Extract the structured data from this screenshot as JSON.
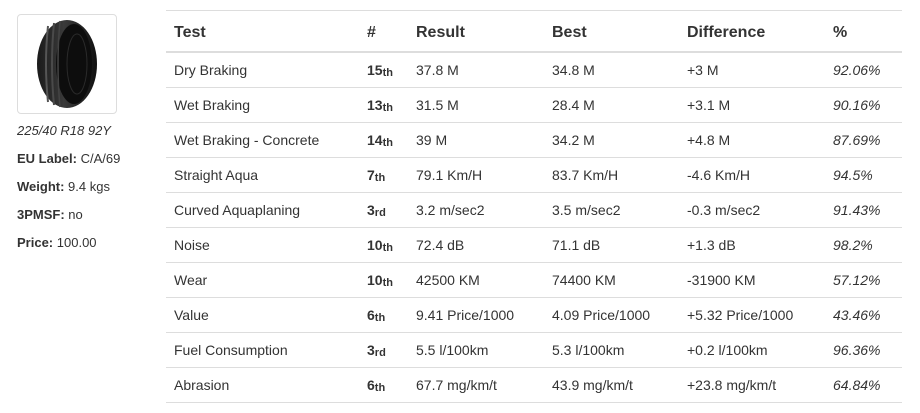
{
  "tyre": {
    "size": "225/40 R18 92Y",
    "specs": [
      {
        "label": "EU Label:",
        "value": "C/A/69"
      },
      {
        "label": "Weight:",
        "value": "9.4 kgs"
      },
      {
        "label": "3PMSF:",
        "value": "no"
      },
      {
        "label": "Price:",
        "value": "100.00"
      }
    ]
  },
  "table": {
    "headers": [
      "Test",
      "#",
      "Result",
      "Best",
      "Difference",
      "%"
    ],
    "rows": [
      {
        "test": "Dry Braking",
        "rank": "15",
        "suffix": "th",
        "result": "37.8 M",
        "best": "34.8 M",
        "difference": "+3 M",
        "percent": "92.06%"
      },
      {
        "test": "Wet Braking",
        "rank": "13",
        "suffix": "th",
        "result": "31.5 M",
        "best": "28.4 M",
        "difference": "+3.1 M",
        "percent": "90.16%"
      },
      {
        "test": "Wet Braking - Concrete",
        "rank": "14",
        "suffix": "th",
        "result": "39 M",
        "best": "34.2 M",
        "difference": "+4.8 M",
        "percent": "87.69%"
      },
      {
        "test": "Straight Aqua",
        "rank": "7",
        "suffix": "th",
        "result": "79.1 Km/H",
        "best": "83.7 Km/H",
        "difference": "-4.6 Km/H",
        "percent": "94.5%"
      },
      {
        "test": "Curved Aquaplaning",
        "rank": "3",
        "suffix": "rd",
        "result": "3.2 m/sec2",
        "best": "3.5 m/sec2",
        "difference": "-0.3 m/sec2",
        "percent": "91.43%"
      },
      {
        "test": "Noise",
        "rank": "10",
        "suffix": "th",
        "result": "72.4 dB",
        "best": "71.1 dB",
        "difference": "+1.3 dB",
        "percent": "98.2%"
      },
      {
        "test": "Wear",
        "rank": "10",
        "suffix": "th",
        "result": "42500 KM",
        "best": "74400 KM",
        "difference": "-31900 KM",
        "percent": "57.12%"
      },
      {
        "test": "Value",
        "rank": "6",
        "suffix": "th",
        "result": "9.41 Price/1000",
        "best": "4.09 Price/1000",
        "difference": "+5.32 Price/1000",
        "percent": "43.46%"
      },
      {
        "test": "Fuel Consumption",
        "rank": "3",
        "suffix": "rd",
        "result": "5.5 l/100km",
        "best": "5.3 l/100km",
        "difference": "+0.2 l/100km",
        "percent": "96.36%"
      },
      {
        "test": "Abrasion",
        "rank": "6",
        "suffix": "th",
        "result": "67.7 mg/km/t",
        "best": "43.9 mg/km/t",
        "difference": "+23.8 mg/km/t",
        "percent": "64.84%"
      }
    ]
  }
}
